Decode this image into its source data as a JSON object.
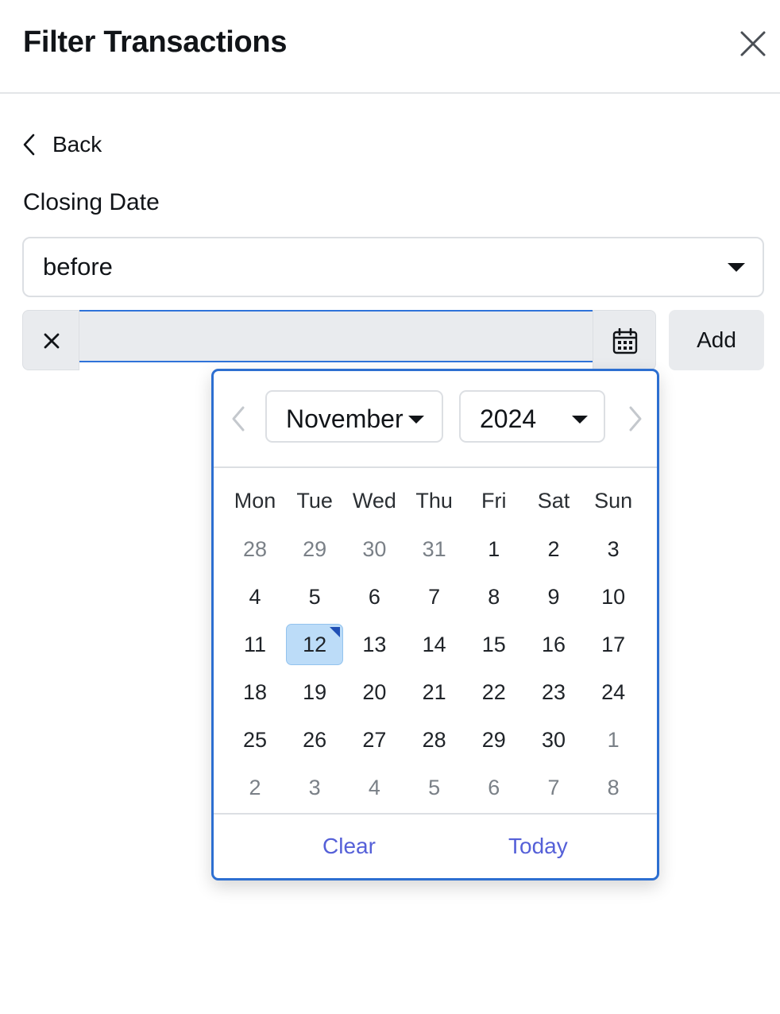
{
  "panel": {
    "title": "Filter Transactions",
    "back_label": "Back",
    "field_label": "Closing Date",
    "operator": "before",
    "date_value": "",
    "add_label": "Add"
  },
  "datepicker": {
    "month": "November",
    "year": "2024",
    "weekdays": [
      "Mon",
      "Tue",
      "Wed",
      "Thu",
      "Fri",
      "Sat",
      "Sun"
    ],
    "weeks": [
      [
        "28",
        "29",
        "30",
        "31",
        "1",
        "2",
        "3"
      ],
      [
        "4",
        "5",
        "6",
        "7",
        "8",
        "9",
        "10"
      ],
      [
        "11",
        "12",
        "13",
        "14",
        "15",
        "16",
        "17"
      ],
      [
        "18",
        "19",
        "20",
        "21",
        "22",
        "23",
        "24"
      ],
      [
        "25",
        "26",
        "27",
        "28",
        "29",
        "30",
        "1"
      ],
      [
        "2",
        "3",
        "4",
        "5",
        "6",
        "7",
        "8"
      ]
    ],
    "selected_day": "12",
    "clear_label": "Clear",
    "today_label": "Today"
  },
  "colors": {
    "accent": "#2d6fd1",
    "selected_bg": "#bcdcf8",
    "link": "#5560d8"
  },
  "icons": {
    "close": "close-icon",
    "back": "chevron-left-icon",
    "caret": "caret-down-icon",
    "clear": "x-icon",
    "calendar": "calendar-icon",
    "prev": "chevron-left-icon",
    "next": "chevron-right-icon"
  }
}
